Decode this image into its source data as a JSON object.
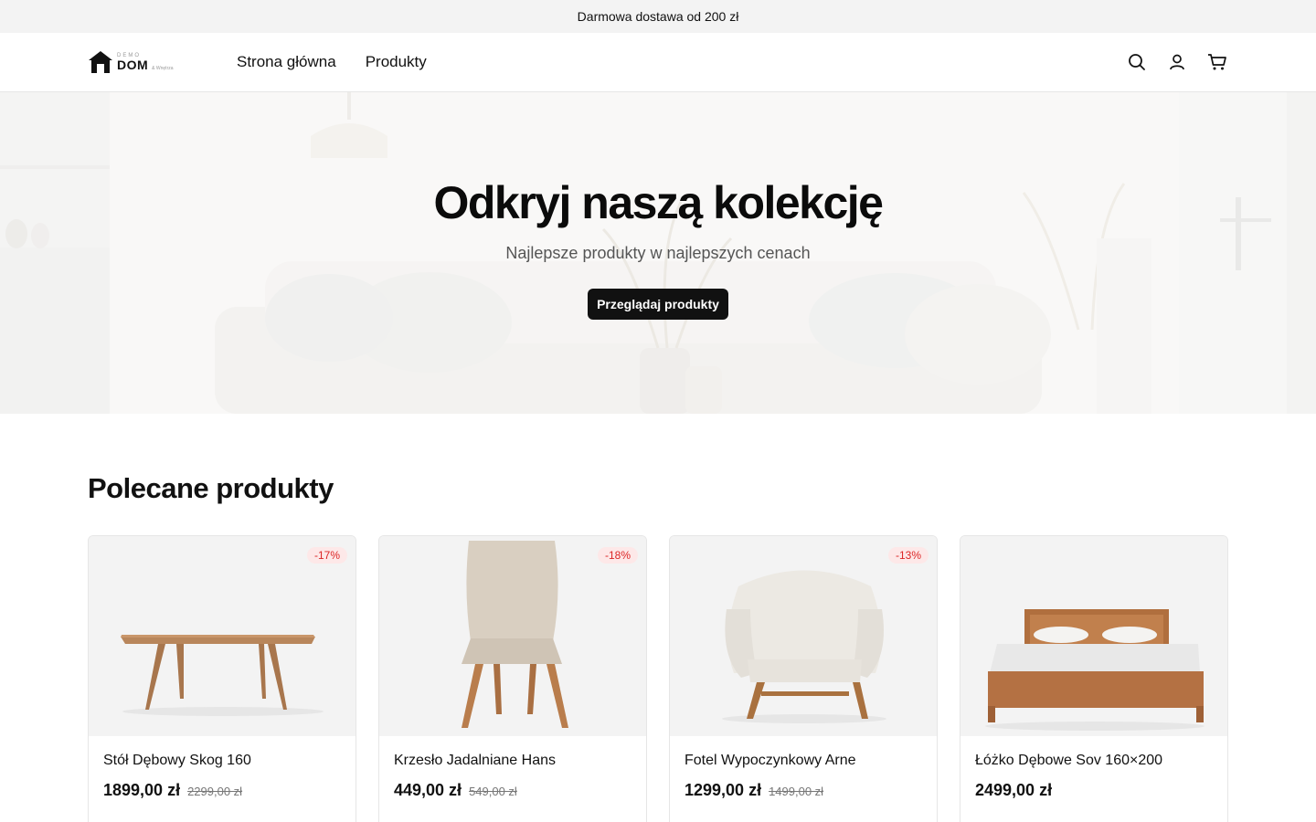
{
  "announcement": {
    "text": "Darmowa dostawa od 200 zł"
  },
  "header": {
    "logo": {
      "small": "DEMO",
      "main": "DOM",
      "sub": "& Wnętrza"
    },
    "nav": [
      {
        "label": "Strona główna"
      },
      {
        "label": "Produkty"
      }
    ],
    "icons": [
      "search-icon",
      "account-icon",
      "cart-icon"
    ]
  },
  "hero": {
    "title": "Odkryj naszą kolekcję",
    "subtitle": "Najlepsze produkty w najlepszych cenach",
    "cta": "Przeglądaj produkty"
  },
  "featured": {
    "title": "Polecane produkty",
    "products": [
      {
        "name": "Stół Dębowy Skog 160",
        "price": "1899,00 zł",
        "old_price": "2299,00 zł",
        "badge": "-17%",
        "image": "table"
      },
      {
        "name": "Krzesło Jadalniane Hans",
        "price": "449,00 zł",
        "old_price": "549,00 zł",
        "badge": "-18%",
        "image": "chair"
      },
      {
        "name": "Fotel Wypoczynkowy Arne",
        "price": "1299,00 zł",
        "old_price": "1499,00 zł",
        "badge": "-13%",
        "image": "armchair"
      },
      {
        "name": "Łóżko Dębowe Sov 160×200",
        "price": "2499,00 zł",
        "old_price": "",
        "badge": "",
        "image": "bed"
      }
    ]
  },
  "colors": {
    "accent": "#111111",
    "badge_bg": "#fde8e8",
    "badge_text": "#dc2626",
    "announcement_bg": "#f3f3f3"
  }
}
